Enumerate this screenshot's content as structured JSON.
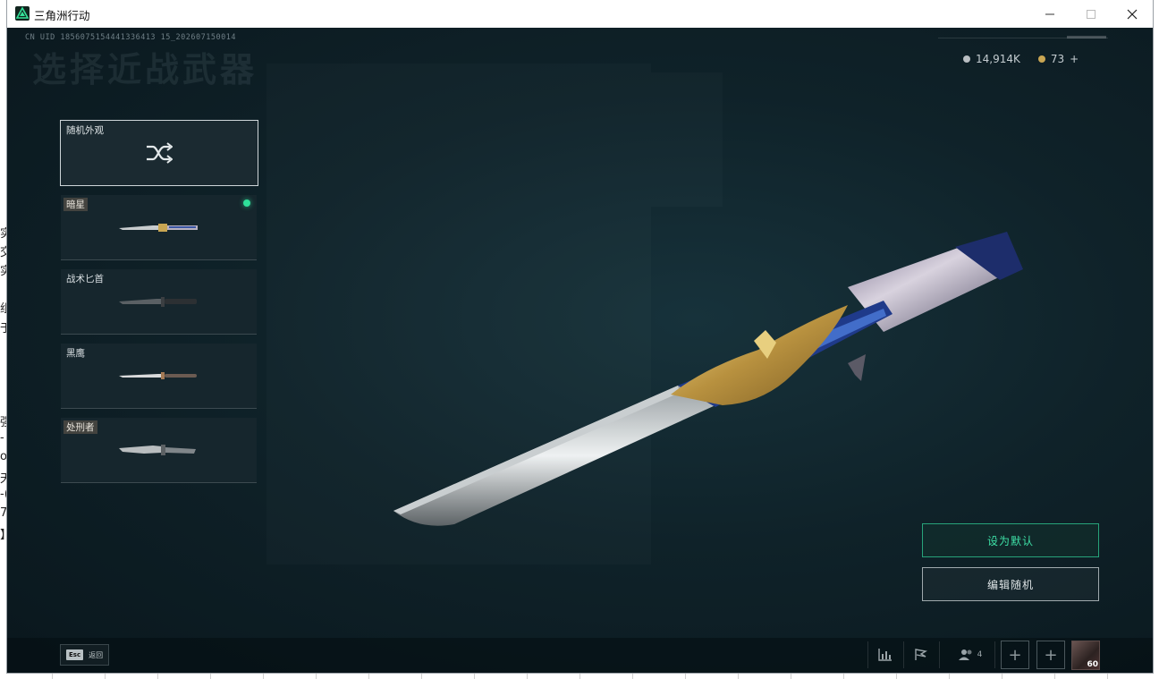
{
  "window": {
    "title": "三角洲行动"
  },
  "background_fragments": [
    "实",
    "交",
    "实",
    "组",
    "于",
    "强",
    "-",
    "o",
    "天",
    "-(",
    "7",
    "】"
  ],
  "header": {
    "uid": "CN UID 1856075154441336413 15_202607150014",
    "title": "选择近战武器"
  },
  "currency": {
    "silver_amount": "14,914K",
    "gold_amount": "73",
    "add_symbol": "+"
  },
  "random_skin": {
    "label": "随机外观",
    "icon": "shuffle-icon"
  },
  "weapons": [
    {
      "name": "暗星",
      "tagged": true,
      "equipped": true
    },
    {
      "name": "战术匕首",
      "tagged": false,
      "equipped": false
    },
    {
      "name": "黑鹰",
      "tagged": false,
      "equipped": false
    },
    {
      "name": "处刑者",
      "tagged": true,
      "equipped": false
    }
  ],
  "actions": {
    "set_default": "设为默认",
    "edit_random": "编辑随机"
  },
  "bottombar": {
    "esc_key": "Esc",
    "esc_label": "返回",
    "friend_count": "4",
    "player_level": "60"
  },
  "colors": {
    "accent_green": "#3ee0a6",
    "equipped_dot": "#2fe09a",
    "background": "#0d1a21"
  }
}
